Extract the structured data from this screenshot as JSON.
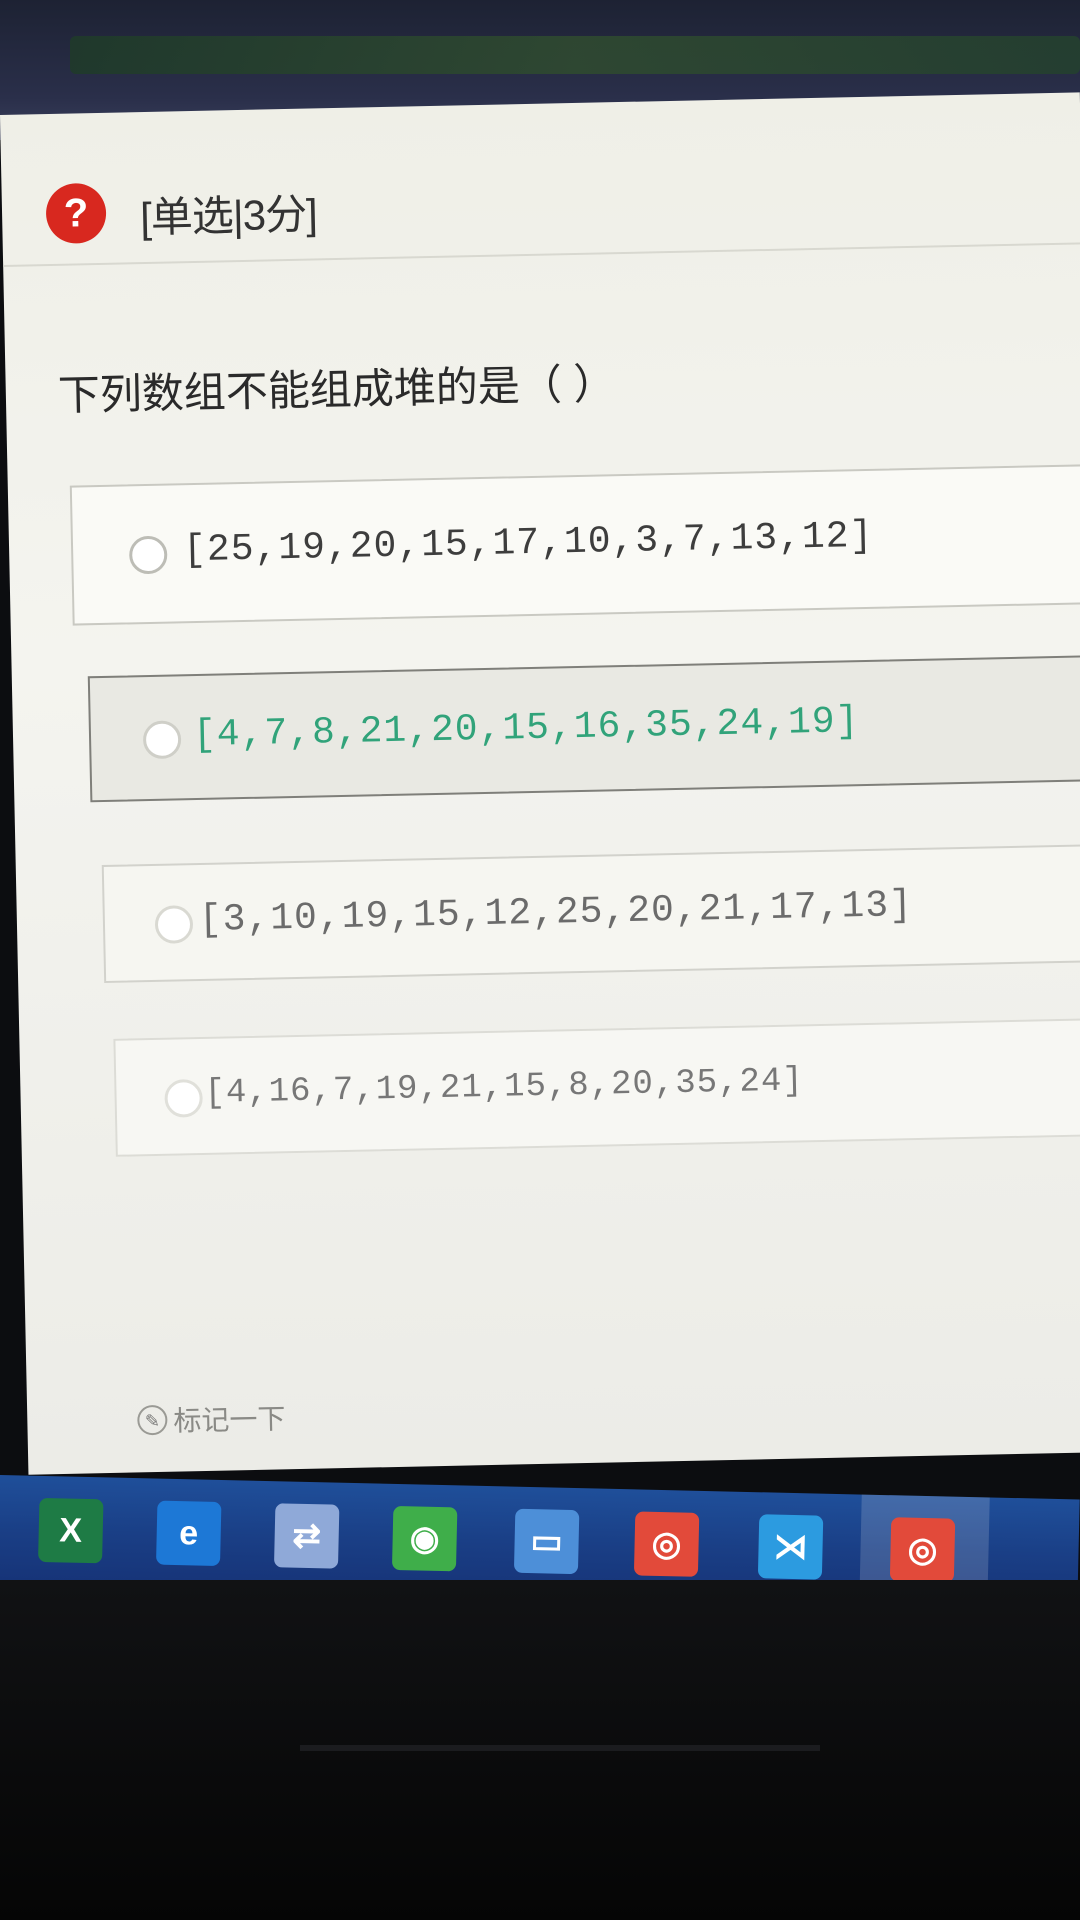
{
  "question": {
    "type_label": "[单选|3分]",
    "prompt": "下列数组不能组成堆的是（ ）",
    "options": [
      {
        "text": "[25,19,20,15,17,10,3,7,13,12]"
      },
      {
        "text": "[4,7,8,21,20,15,16,35,24,19]"
      },
      {
        "text": "[3,10,19,15,12,25,20,21,17,13]"
      },
      {
        "text": "[4,16,7,19,21,15,8,20,35,24]"
      }
    ],
    "mark_label": "标记一下"
  },
  "icons": {
    "question": "question-mark-icon",
    "mark": "pin-icon"
  },
  "taskbar": {
    "apps": [
      {
        "name": "excel-icon",
        "glyph": "X",
        "color": "#1e7b45"
      },
      {
        "name": "edge-icon",
        "glyph": "e",
        "color": "#1d78d6"
      },
      {
        "name": "file-transfer-icon",
        "glyph": "⇄",
        "color": "#8fa9d8"
      },
      {
        "name": "browser-globe-icon",
        "glyph": "◉",
        "color": "#3fae4a"
      },
      {
        "name": "file-explorer-icon",
        "glyph": "▭",
        "color": "#4d8fd8"
      },
      {
        "name": "chrome-icon",
        "glyph": "◎",
        "color": "#e24a3a"
      },
      {
        "name": "vscode-icon",
        "glyph": "⋊",
        "color": "#2c9be0"
      },
      {
        "name": "chrome-icon",
        "glyph": "◎",
        "color": "#e24a3a"
      }
    ]
  },
  "colors": {
    "accent_green": "#31a37a",
    "question_red": "#d8281f",
    "taskbar_blue": "#1a3f86"
  }
}
